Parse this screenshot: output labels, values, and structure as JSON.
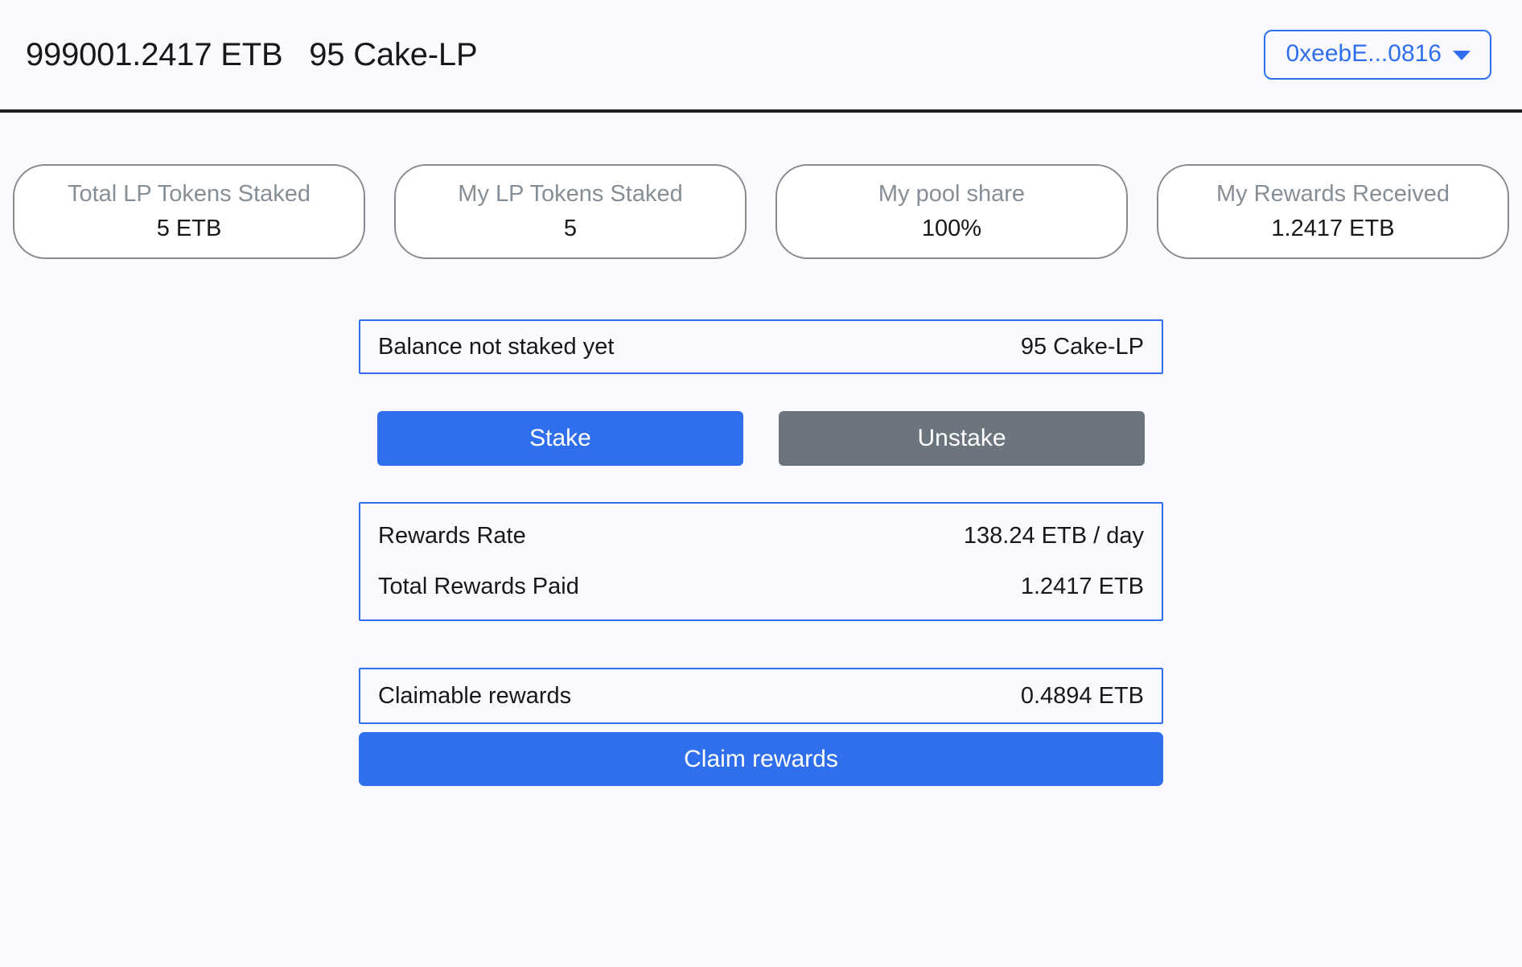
{
  "header": {
    "title": "999001.2417 ETB   95 Cake-LP",
    "wallet": {
      "address_label": "0xeebE...0816",
      "caret_icon": "chevron-down-icon"
    }
  },
  "stats": [
    {
      "label": "Total LP Tokens Staked",
      "value": "5 ETB"
    },
    {
      "label": "My LP Tokens Staked",
      "value": "5"
    },
    {
      "label": "My pool share",
      "value": "100%"
    },
    {
      "label": "My Rewards Received",
      "value": "1.2417 ETB"
    }
  ],
  "balance": {
    "label": "Balance not staked yet",
    "value": "95 Cake-LP"
  },
  "actions": {
    "stake_label": "Stake",
    "unstake_label": "Unstake"
  },
  "rewards": {
    "rate_label": "Rewards Rate",
    "rate_value": "138.24 ETB / day",
    "total_paid_label": "Total Rewards Paid",
    "total_paid_value": "1.2417 ETB"
  },
  "claim": {
    "claimable_label": "Claimable rewards",
    "claimable_value": "0.4894 ETB",
    "claim_button_label": "Claim rewards"
  },
  "colors": {
    "page_background": "#faf9ff",
    "accent_blue": "#2f6fed",
    "secondary_gray": "#6c757d",
    "card_border": "#8a8a8e",
    "muted_text": "#868e96",
    "body_text": "#16181b"
  }
}
